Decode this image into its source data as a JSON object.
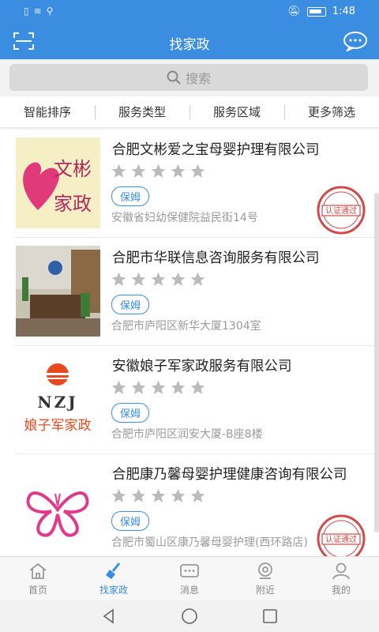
{
  "status": {
    "time": "1:48",
    "left_icons": "📶 ⚡",
    "battery_icon": "battery-icon"
  },
  "header": {
    "title": "找家政"
  },
  "search": {
    "placeholder": "搜索"
  },
  "filters": [
    "智能排序",
    "服务类型",
    "服务区域",
    "更多筛选"
  ],
  "listings": [
    {
      "name": "合肥文彬爱之宝母婴护理有限公司",
      "tag": "保姆",
      "address": "安徽省妇幼保健院益民街14号",
      "verified": true,
      "stamp_text": "认证通过",
      "logo_text": [
        "文彬",
        "家政"
      ]
    },
    {
      "name": "合肥市华联信息咨询服务有限公司",
      "tag": "保姆",
      "address": "合肥市庐阳区新华大厦1304室",
      "verified": false
    },
    {
      "name": "安徽娘子军家政服务有限公司",
      "tag": "保姆",
      "address": "合肥市庐阳区润安大厦-B座8楼",
      "verified": false,
      "logo_text": [
        "NZJ",
        "娘子军家政"
      ]
    },
    {
      "name": "合肥康乃馨母婴护理健康咨询有限公司",
      "tag": "保姆",
      "address": "合肥市蜀山区康乃馨母婴护理(西环路店)",
      "verified": true,
      "stamp_text": "认证通过"
    }
  ],
  "tabbar": [
    {
      "label": "首页",
      "icon": "home-icon",
      "active": false
    },
    {
      "label": "找家政",
      "icon": "broom-icon",
      "active": true
    },
    {
      "label": "消息",
      "icon": "message-icon",
      "active": false
    },
    {
      "label": "附近",
      "icon": "location-icon",
      "active": false
    },
    {
      "label": "我的",
      "icon": "user-icon",
      "active": false
    }
  ],
  "colors": {
    "primary": "#3a8de0",
    "star": "#bbbbbb",
    "stamp": "#d04a4a"
  }
}
